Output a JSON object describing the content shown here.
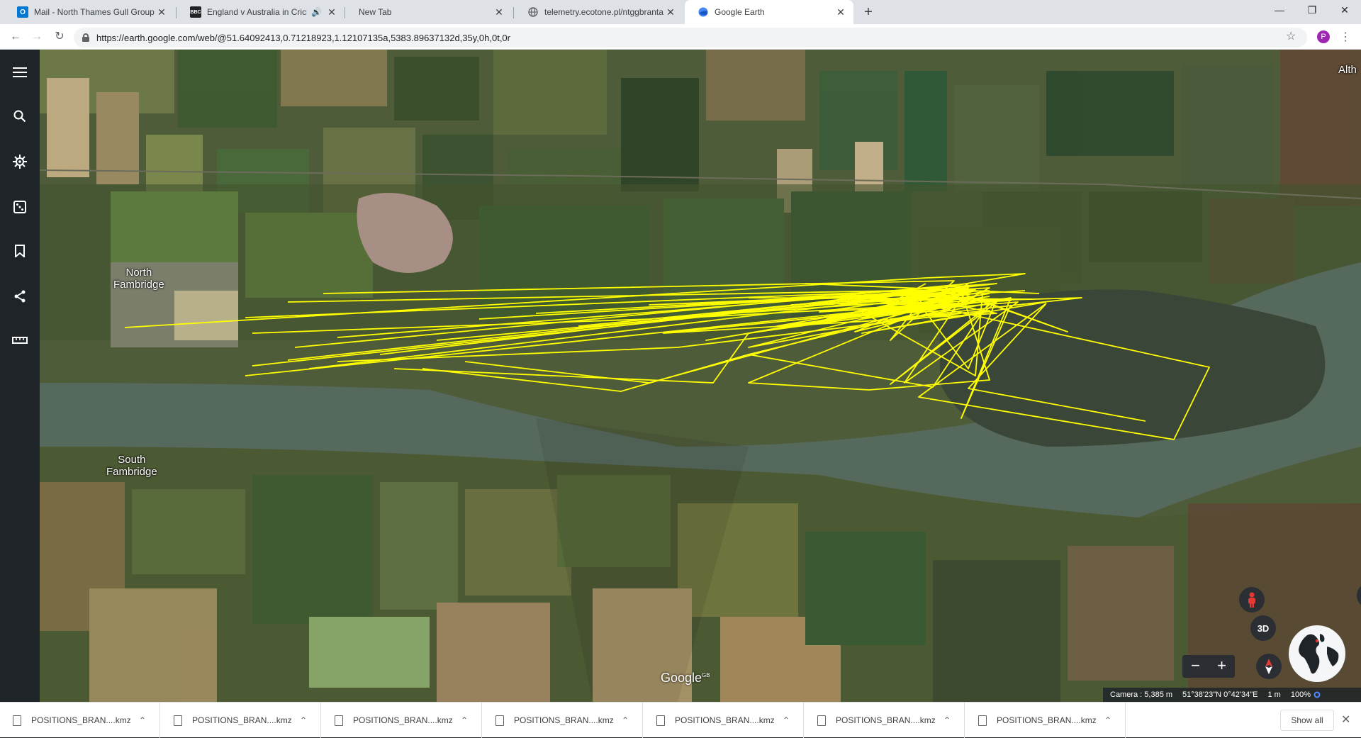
{
  "tabs": [
    {
      "title": "Mail - North Thames Gull Group",
      "icon": "outlook-icon",
      "color": "#0078d4"
    },
    {
      "title": "England v Australia in Cricket",
      "icon": "bbc-icon",
      "color": "#202124",
      "audio": true
    },
    {
      "title": "New Tab",
      "icon": "none"
    },
    {
      "title": "telemetry.ecotone.pl/ntggbranta",
      "icon": "globe-icon"
    },
    {
      "title": "Google Earth",
      "icon": "google-earth-icon",
      "active": true
    }
  ],
  "address_bar": {
    "url": "https://earth.google.com/web/@51.64092413,0.71218923,1.12107135a,5383.89637132d,35y,0h,0t,0r"
  },
  "profile_initial": "P",
  "map": {
    "labels": {
      "north_fambridge": "North\nFambridge",
      "south_fambridge": "South\nFambridge",
      "top_right": "Alth"
    },
    "google_logo": "Google",
    "google_logo_sup": "GB",
    "track_color": "#ffff00",
    "controls": {
      "three_d": "3D"
    },
    "status": {
      "camera": "Camera :  5,385 m",
      "coords": "51°38'23\"N 0°42'34\"E",
      "elevation": "1 m",
      "zoom": "100%"
    }
  },
  "downloads": [
    {
      "name": "POSITIONS_BRAN....kmz"
    },
    {
      "name": "POSITIONS_BRAN....kmz"
    },
    {
      "name": "POSITIONS_BRAN....kmz"
    },
    {
      "name": "POSITIONS_BRAN....kmz"
    },
    {
      "name": "POSITIONS_BRAN....kmz"
    },
    {
      "name": "POSITIONS_BRAN....kmz"
    },
    {
      "name": "POSITIONS_BRAN....kmz"
    }
  ],
  "show_all_label": "Show all"
}
